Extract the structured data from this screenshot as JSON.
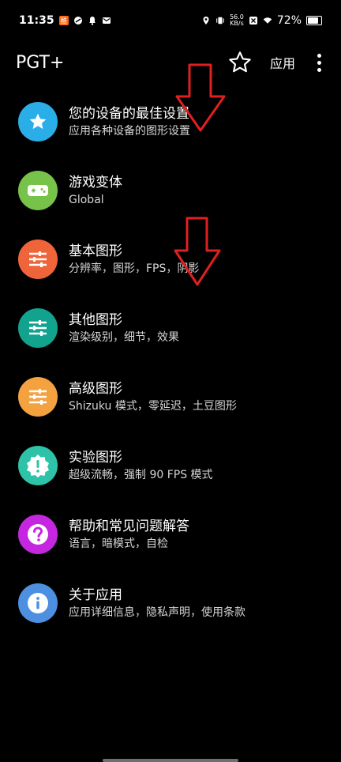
{
  "status_bar": {
    "time": "11:35",
    "net_speed_value": "56.0",
    "net_speed_unit": "KB/s",
    "battery": "72%"
  },
  "app_bar": {
    "title": "PGT+",
    "apply_label": "应用"
  },
  "menu": [
    {
      "title": "您的设备的最佳设置",
      "subtitle": "应用各种设备的图形设置",
      "icon": "star-icon",
      "color": "#2aaee8"
    },
    {
      "title": "游戏变体",
      "subtitle": "Global",
      "icon": "gamepad-icon",
      "color": "#77c248"
    },
    {
      "title": "基本图形",
      "subtitle": "分辨率，图形，FPS，阴影",
      "icon": "sliders-icon",
      "color": "#f0643a"
    },
    {
      "title": "其他图形",
      "subtitle": "渲染级别，细节，效果",
      "icon": "sliders-icon",
      "color": "#12a38f"
    },
    {
      "title": "高级图形",
      "subtitle": "Shizuku 模式，零延迟，土豆图形",
      "icon": "sliders-icon",
      "color": "#f4a13f"
    },
    {
      "title": "实验图形",
      "subtitle": "超级流畅，强制 90 FPS 模式",
      "icon": "alert-badge-icon",
      "color": "#2ec3a8"
    },
    {
      "title": "帮助和常见问题解答",
      "subtitle": "语言，暗模式，自检",
      "icon": "question-icon",
      "color": "#c526e0"
    },
    {
      "title": "关于应用",
      "subtitle": "应用详细信息，隐私声明，使用条款",
      "icon": "info-icon",
      "color": "#4d8fe0"
    }
  ],
  "colors": {
    "background": "#000000",
    "annotation_arrow": "#e02020"
  }
}
